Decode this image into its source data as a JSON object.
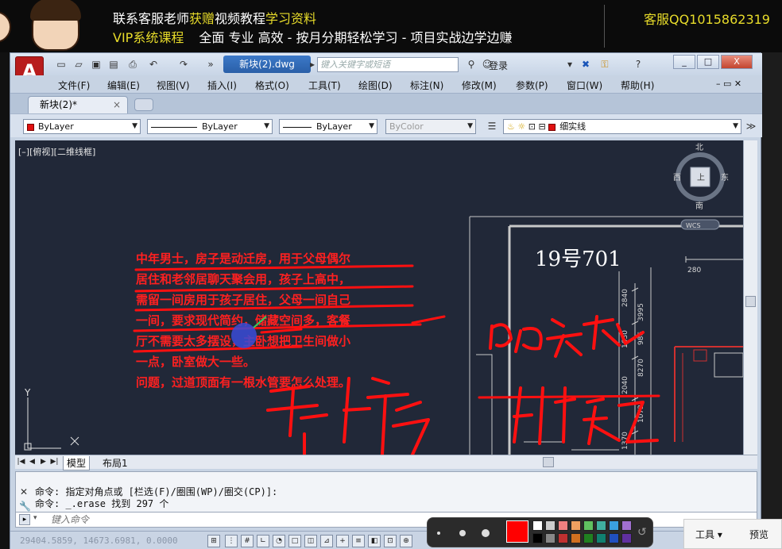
{
  "banner": {
    "line1_a": "联系客服老师",
    "line1_b": "获赠",
    "line1_c": "视频教程",
    "line1_d": "学习资料",
    "line2_a": "VIP系统课程",
    "line2_b": "全面  专业  高效  -  按月分期轻松学习  -  项目实战边学边赚",
    "qq": "客服QQ1015862319",
    "colors": {
      "yellow": "#e8dc2a",
      "white": "#ffffff"
    }
  },
  "titlebar": {
    "app_letter": "A",
    "doc_title": "新块(2).dwg",
    "search_placeholder": "键入关键字或短语",
    "login": "登录",
    "min": "_",
    "max": "□",
    "close": "X"
  },
  "menu": [
    "文件(F)",
    "编辑(E)",
    "视图(V)",
    "插入(I)",
    "格式(O)",
    "工具(T)",
    "绘图(D)",
    "标注(N)",
    "修改(M)",
    "参数(P)",
    "窗口(W)",
    "帮助(H)"
  ],
  "tabs": {
    "file_tab": "新块(2)*",
    "close": "×"
  },
  "properties": {
    "color": "ByLayer",
    "linetype": "ByLayer",
    "lineweight": "ByLayer",
    "plotstyle": "ByColor",
    "layer": "细实线"
  },
  "canvas": {
    "view_label": "[–][俯视][二维线框]",
    "viewcube": {
      "north": "北",
      "south": "南",
      "east": "东",
      "west": "西",
      "top": "上",
      "wcs": "WCS"
    },
    "unit_title": "19号701",
    "note_lines": [
      "中年男士，房子是动迁房，用于父母偶尔",
      "居住和老邻居聊天聚会用，孩子上高中，",
      "需留一间房用于孩子居住，父母一间自己",
      "一间，要求现代简约，储藏空间多，客餐",
      "厅不需要太多摆设，主卧想把卫生间做小",
      "一点，卧室做大一些。",
      "问题，过道顶面有一根水管要怎么处理。"
    ],
    "dims": [
      "280",
      "2840",
      "3995",
      "986",
      "1630",
      "8270",
      "2040",
      "1073",
      "1370"
    ],
    "handwriting": [
      "白色卷帘",
      "上下门",
      "石膏"
    ],
    "axis_y": "Y"
  },
  "layout_tabs": {
    "model": "模型",
    "layout1": "布局1"
  },
  "command": {
    "line1": "命令: 指定对角点或 [栏选(F)/圈围(WP)/圈交(CP)]:",
    "line2": "命令: _.erase 找到 297 个",
    "input_placeholder": "键入命令",
    "close": "✕",
    "wrench": "🔧"
  },
  "status": {
    "coords": "29404.5859, 14673.6981, 0.0000"
  },
  "anno": {
    "current_color": "#ff0000",
    "palette": [
      "#ffffff",
      "#cccccc",
      "#f08080",
      "#f0a060",
      "#60c060",
      "#40b0a0",
      "#3aa0e0",
      "#a070d0",
      "#000000",
      "#888888",
      "#c03030",
      "#d07020",
      "#208020",
      "#108070",
      "#2050c0",
      "#6030a0"
    ]
  },
  "right_panel": {
    "tools": "工具 ▾",
    "preview": "预览"
  }
}
